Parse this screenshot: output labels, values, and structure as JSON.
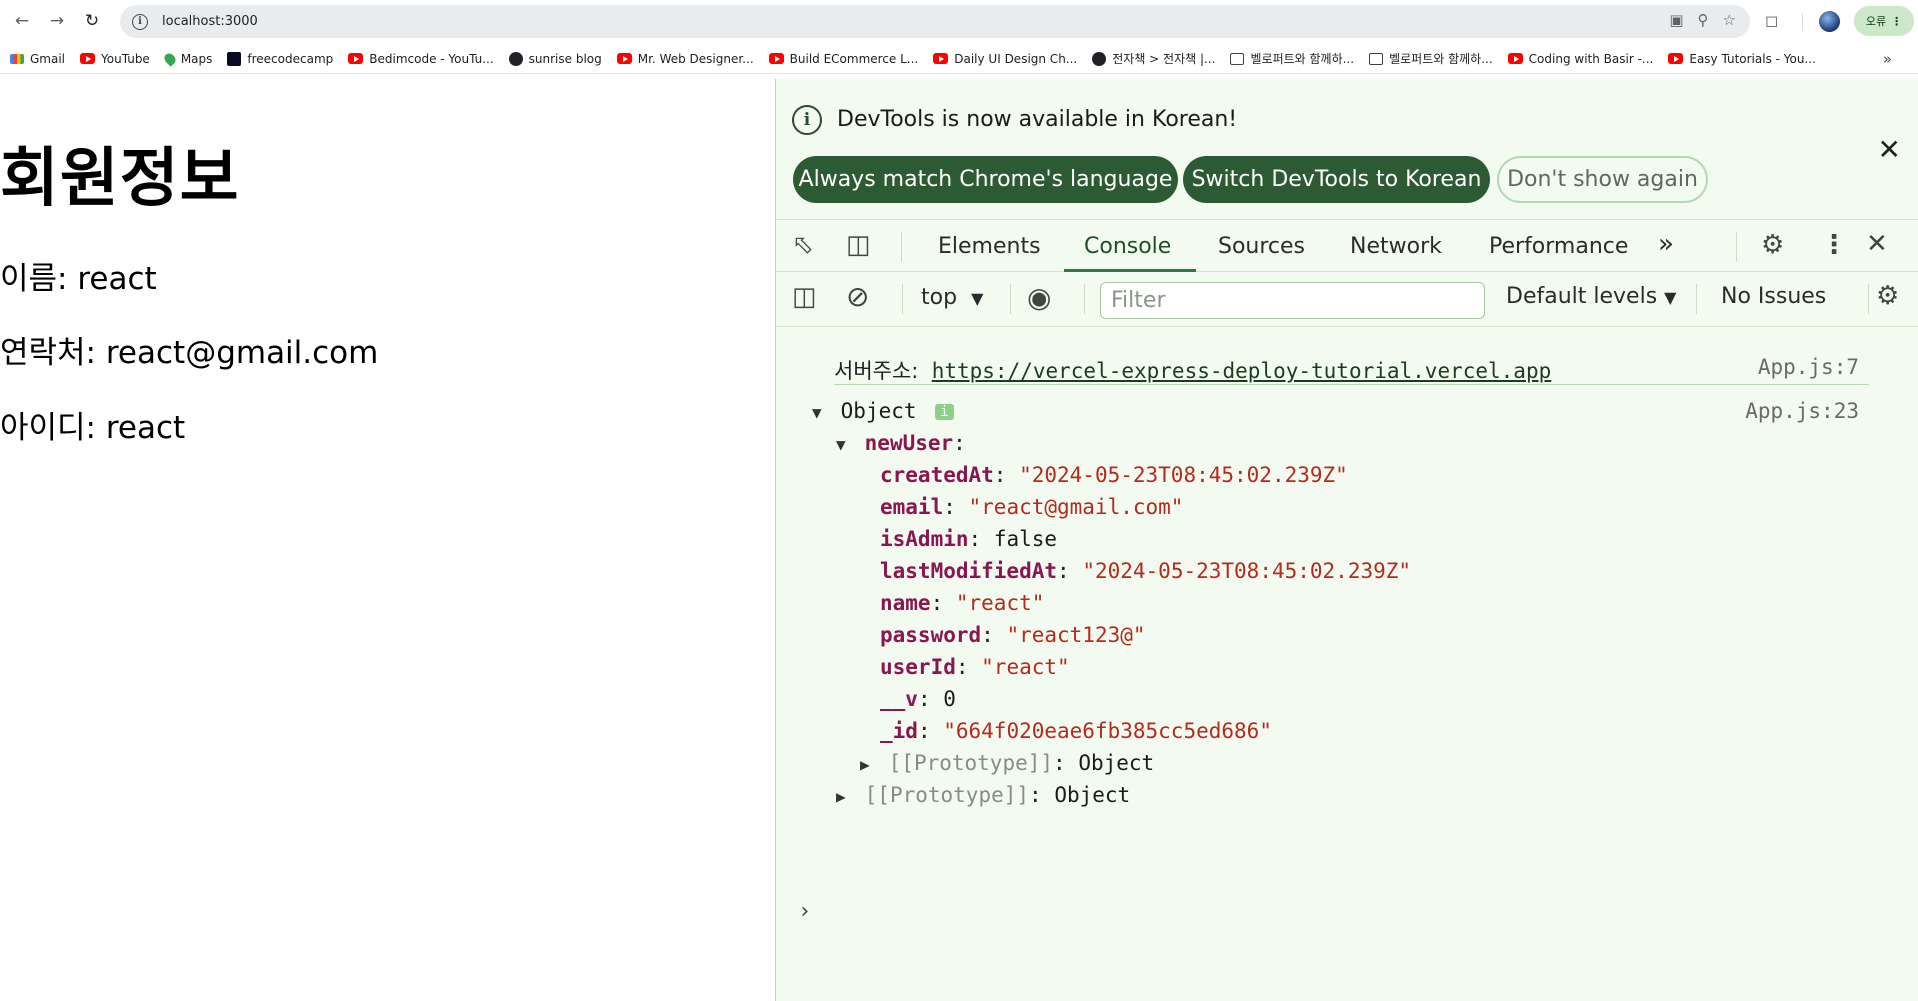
{
  "browser": {
    "url": "localhost:3000",
    "error_chip": "오류"
  },
  "bookmarks": [
    {
      "label": "Gmail",
      "icon": "gmail-icon"
    },
    {
      "label": "YouTube",
      "icon": "youtube-icon"
    },
    {
      "label": "Maps",
      "icon": "maps-pin-icon"
    },
    {
      "label": "freecodecamp",
      "icon": "freecodecamp-icon"
    },
    {
      "label": "Bedimcode - YouTu...",
      "icon": "youtube-icon"
    },
    {
      "label": "sunrise blog",
      "icon": "globe-icon"
    },
    {
      "label": "Mr. Web Designer...",
      "icon": "youtube-icon"
    },
    {
      "label": "Build ECommerce L...",
      "icon": "youtube-icon"
    },
    {
      "label": "Daily UI Design Ch...",
      "icon": "youtube-icon"
    },
    {
      "label": "전자책 > 전자책 |...",
      "icon": "globe-icon"
    },
    {
      "label": "벨로퍼트와 함께하...",
      "icon": "book-icon"
    },
    {
      "label": "벨로퍼트와 함께하...",
      "icon": "book-icon"
    },
    {
      "label": "Coding with Basir -...",
      "icon": "youtube-icon"
    },
    {
      "label": "Easy Tutorials - You...",
      "icon": "youtube-icon"
    }
  ],
  "page": {
    "title": "회원정보",
    "name_line": "이름: react",
    "contact_line": "연락처: react@gmail.com",
    "id_line": "아이디: react"
  },
  "devtools": {
    "infobar": {
      "message": "DevTools is now available in Korean!",
      "btn_match": "Always match Chrome's language",
      "btn_switch": "Switch DevTools to Korean",
      "btn_dismiss": "Don't show again"
    },
    "tabs": [
      "Elements",
      "Console",
      "Sources",
      "Network",
      "Performance"
    ],
    "toolbar": {
      "context": "top",
      "filter_placeholder": "Filter",
      "levels": "Default levels",
      "issues": "No Issues"
    },
    "console": {
      "log1_label": "서버주소:",
      "log1_link": "https://vercel-express-deploy-tutorial.vercel.app",
      "log1_src": "App.js:7",
      "log2_label": "Object",
      "log2_src": "App.js:23",
      "newUser_key": "newUser",
      "fields": [
        {
          "key": "createdAt",
          "value": "\"2024-05-23T08:45:02.239Z\"",
          "type": "str"
        },
        {
          "key": "email",
          "value": "\"react@gmail.com\"",
          "type": "str"
        },
        {
          "key": "isAdmin",
          "value": "false",
          "type": "kw"
        },
        {
          "key": "lastModifiedAt",
          "value": "\"2024-05-23T08:45:02.239Z\"",
          "type": "str"
        },
        {
          "key": "name",
          "value": "\"react\"",
          "type": "str"
        },
        {
          "key": "password",
          "value": "\"react123@\"",
          "type": "str"
        },
        {
          "key": "userId",
          "value": "\"react\"",
          "type": "str"
        },
        {
          "key": "__v",
          "value": "0",
          "type": "num"
        },
        {
          "key": "_id",
          "value": "\"664f020eae6fb385cc5ed686\"",
          "type": "str"
        }
      ],
      "proto_key": "[[Prototype]]",
      "proto_value": "Object"
    }
  }
}
